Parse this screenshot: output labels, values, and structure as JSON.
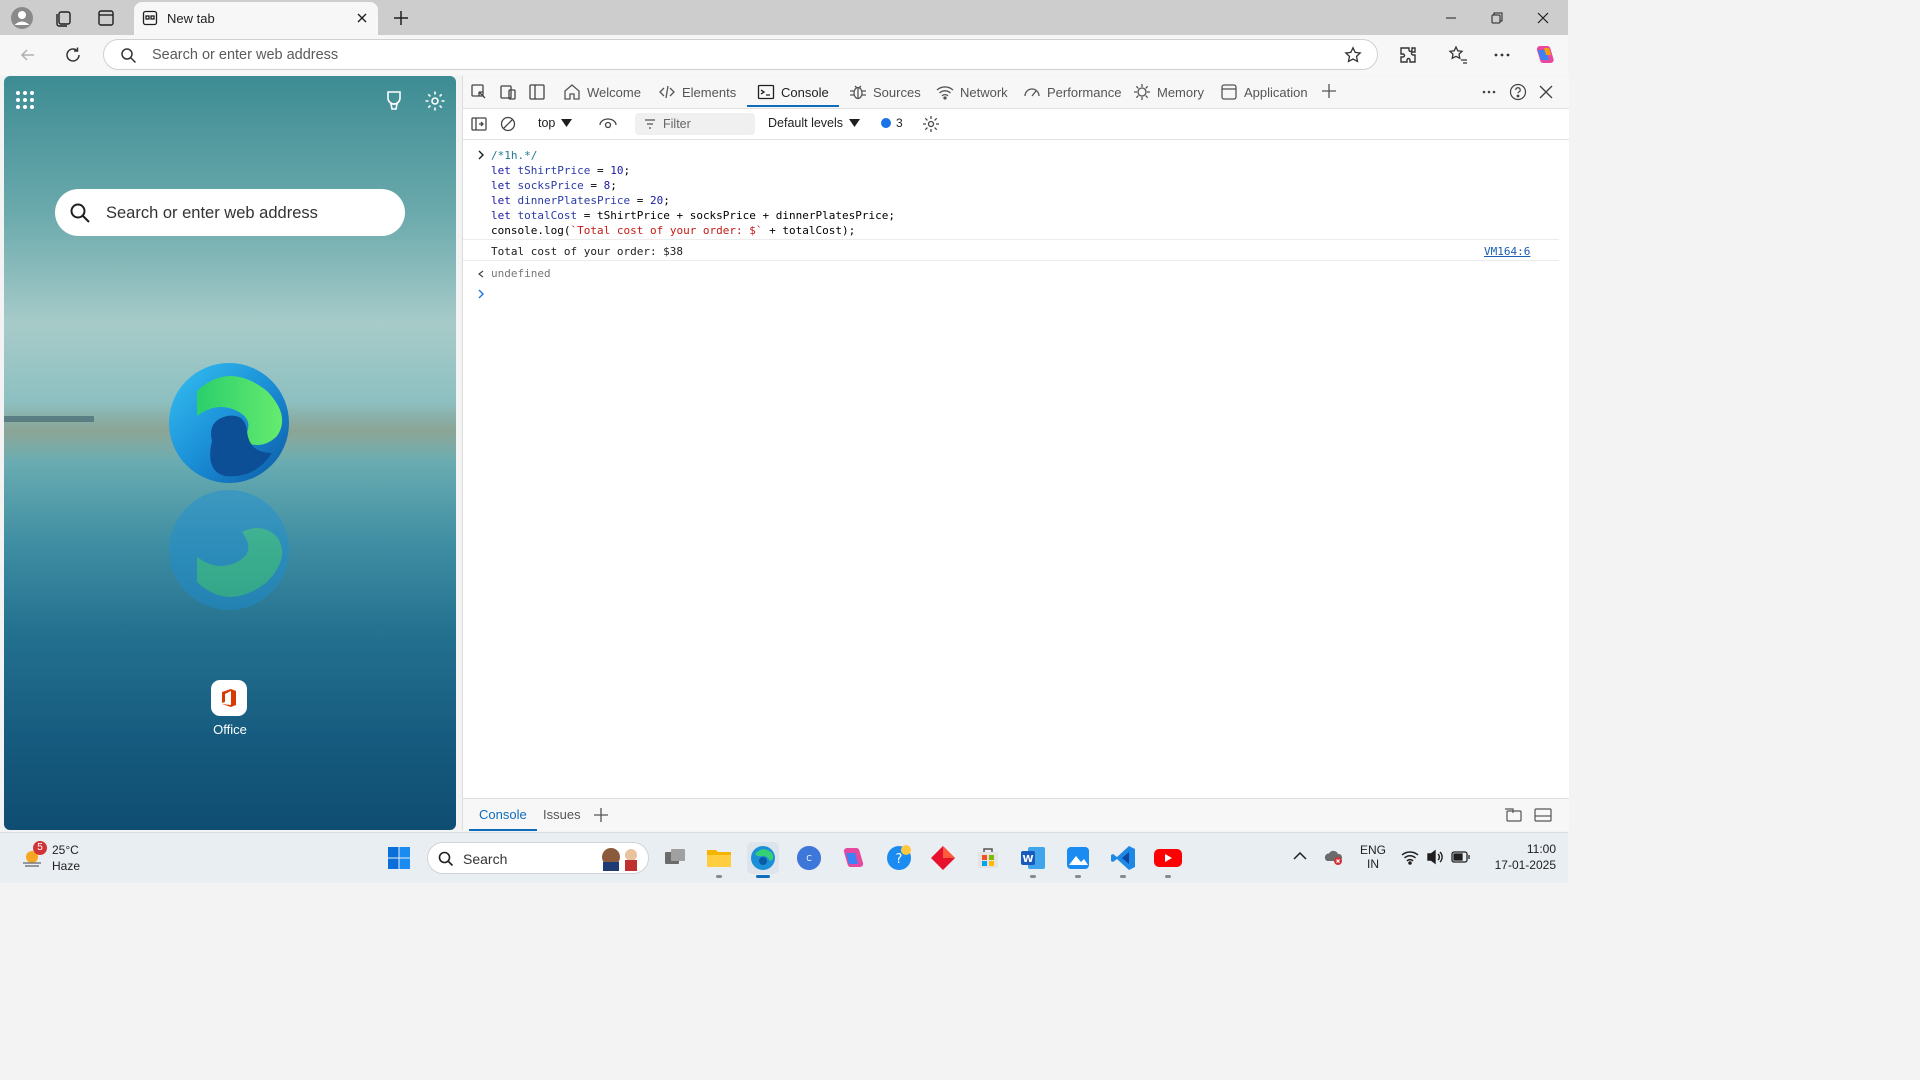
{
  "browser": {
    "tab_title": "New tab",
    "address_placeholder": "Search or enter web address"
  },
  "newtab": {
    "search_placeholder": "Search or enter web address",
    "shortcut_label": "Office"
  },
  "devtools": {
    "tabs": [
      {
        "label": "Welcome",
        "icon": "home-icon"
      },
      {
        "label": "Elements",
        "icon": "code-icon"
      },
      {
        "label": "Console",
        "icon": "console-icon"
      },
      {
        "label": "Sources",
        "icon": "bug-icon"
      },
      {
        "label": "Network",
        "icon": "wifi-icon"
      },
      {
        "label": "Performance",
        "icon": "gauge-icon"
      },
      {
        "label": "Memory",
        "icon": "gear-chip-icon"
      },
      {
        "label": "Application",
        "icon": "app-icon"
      }
    ],
    "active_tab": "Console",
    "context": "top",
    "filter_placeholder": "Filter",
    "levels": "Default levels",
    "issues_count": "3",
    "console": {
      "input_lines": [
        "/*1h.*/",
        "let tShirtPrice = 10;",
        "let socksPrice = 8;",
        "let dinnerPlatesPrice = 20;",
        "let totalCost = tShirtPrice + socksPrice + dinnerPlatesPrice;",
        "console.log(`Total cost of your order: $` + totalCost);"
      ],
      "output": "Total cost of your order: $38",
      "output_source": "VM164:6",
      "return_value": "undefined"
    },
    "drawer_tabs": [
      "Console",
      "Issues"
    ]
  },
  "taskbar": {
    "weather_temp": "25°C",
    "weather_desc": "Haze",
    "weather_badge": "5",
    "search_placeholder": "Search",
    "lang_top": "ENG",
    "lang_bottom": "IN",
    "time": "11:00",
    "date": "17-01-2025"
  }
}
